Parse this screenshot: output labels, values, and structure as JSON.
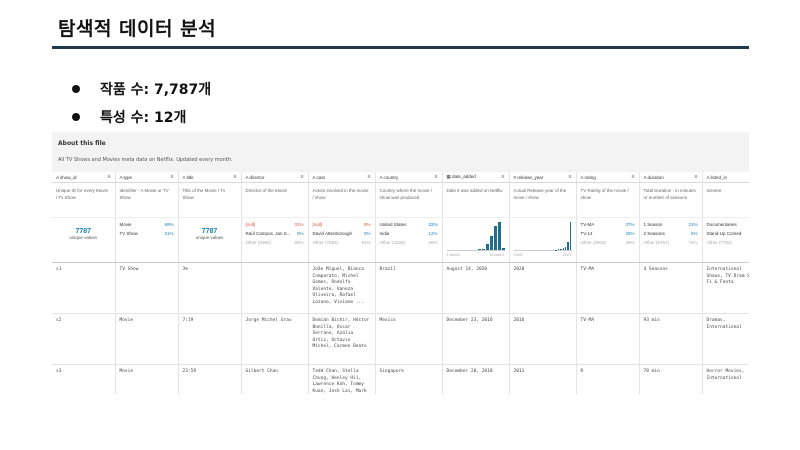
{
  "slide": {
    "title": "탐색적 데이터 분석",
    "bullets": [
      "작품 수: 7,787개",
      "특성 수: 12개"
    ]
  },
  "panel": {
    "about_title": "About this file",
    "about_desc": "All TV Shows and Movies meta data on Netflix. Updated every month.",
    "columns": [
      {
        "icon": "A",
        "name": "show_id",
        "desc": "Unique ID for every Movie / Tv Show"
      },
      {
        "icon": "A",
        "name": "type",
        "desc": "Identifier - A Movie or TV Show"
      },
      {
        "icon": "A",
        "name": "title",
        "desc": "Title of the Movie / Tv Show"
      },
      {
        "icon": "A",
        "name": "director",
        "desc": "Director of the Movie"
      },
      {
        "icon": "A",
        "name": "cast",
        "desc": "Actors involved in the movie / show"
      },
      {
        "icon": "A",
        "name": "country",
        "desc": "Country where the movie / show was produced"
      },
      {
        "icon": "▦",
        "name": "date_added",
        "desc": "Date it was added on Netflix"
      },
      {
        "icon": "#",
        "name": "release_year",
        "desc": "Actual Release year of the move / show"
      },
      {
        "icon": "A",
        "name": "rating",
        "desc": "TV Rating of the movie / show"
      },
      {
        "icon": "A",
        "name": "duration",
        "desc": "Total Duration - in minutes or number of seasons"
      },
      {
        "icon": "A",
        "name": "listed_in",
        "desc": "Genere"
      }
    ],
    "summary": {
      "show_id": {
        "count": "7787",
        "label": "unique values"
      },
      "type": [
        {
          "v": "Movie",
          "p": "69%"
        },
        {
          "v": "TV Show",
          "p": "31%"
        }
      ],
      "title": {
        "count": "7787",
        "label": "unique values"
      },
      "director": [
        {
          "v": "[null]",
          "p": "31%"
        },
        {
          "v": "Raúl Campos, Jan S...",
          "p": "0%"
        },
        {
          "v": "Other (5360)",
          "p": "69%"
        }
      ],
      "cast": [
        {
          "v": "[null]",
          "p": "9%"
        },
        {
          "v": "David Attenborough",
          "p": "0%"
        },
        {
          "v": "Other (7053)",
          "p": "91%"
        }
      ],
      "country": [
        {
          "v": "United States",
          "p": "33%"
        },
        {
          "v": "India",
          "p": "12%"
        },
        {
          "v": "Other (4328)",
          "p": "56%"
        }
      ],
      "date_added": {
        "min": "1Jan08",
        "max": "16Jan21",
        "bars": [
          0,
          0,
          0,
          0,
          0,
          0,
          0,
          0,
          0.02,
          0.05,
          0.2,
          0.5,
          0.85,
          1.0,
          0.08
        ]
      },
      "release_year": {
        "min": "1925",
        "max": "2021",
        "bars": [
          0,
          0,
          0,
          0,
          0,
          0,
          0,
          0,
          0,
          0,
          0,
          0,
          0,
          0,
          0,
          0,
          0,
          0.01,
          0.02,
          0.03,
          0.06,
          0.12,
          0.3,
          1.0
        ]
      },
      "rating": [
        {
          "v": "TV-MA",
          "p": "37%"
        },
        {
          "v": "TV-14",
          "p": "25%"
        },
        {
          "v": "Other (2903)",
          "p": "38%"
        }
      ],
      "duration": [
        {
          "v": "1 Season",
          "p": "21%"
        },
        {
          "v": "2 Seasons",
          "p": "5%"
        },
        {
          "v": "Other (5767)",
          "p": "74%"
        }
      ],
      "listed_in": [
        {
          "v": "Documentaries",
          "p": ""
        },
        {
          "v": "Stand-Up Comed",
          "p": ""
        },
        {
          "v": "Other (7752)",
          "p": ""
        }
      ]
    },
    "rows": [
      [
        "s1",
        "TV Show",
        "3%",
        "",
        "João Miguel, Bianca Comparato, Michel Gomes, Rodolfo Valente, Vaneza Oliveira, Rafael Lozano, Viviane ...",
        "Brazil",
        "August 14, 2020",
        "2020",
        "TV-MA",
        "4 Seasons",
        "International Shows, TV Dram Sci-Fi & Fanta"
      ],
      [
        "s2",
        "Movie",
        "7:19",
        "Jorge Michel Grau",
        "Demián Bichir, Héctor Bonilla, Oscar Serrano, Azalia Ortiz, Octavio Michel, Carmen Beato",
        "Mexico",
        "December 23, 2016",
        "2016",
        "TV-MA",
        "93 min",
        "Dramas, International"
      ],
      [
        "s3",
        "Movie",
        "23:59",
        "Gilbert Chan",
        "Tedd Chan, Stella Chung, Henley Hii, Lawrence Koh, Tommy Kuan, Josh Lai, Mark Lee, Susan Leong, Benj...",
        "Singapore",
        "December 20, 2018",
        "2011",
        "R",
        "78 min",
        "Horror Movies, International"
      ]
    ]
  }
}
